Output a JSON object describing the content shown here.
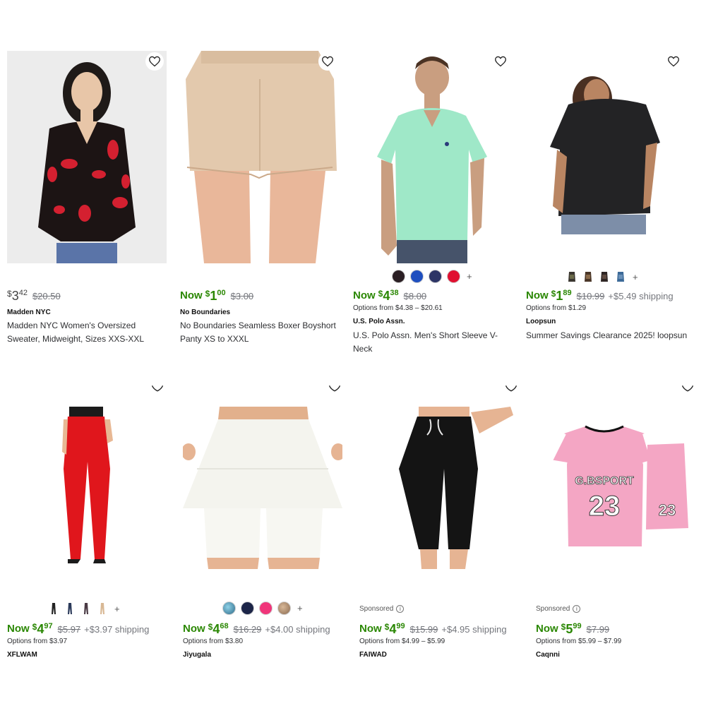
{
  "colors": {
    "accent_green": "#2a8703",
    "muted": "#74767c"
  },
  "products": [
    {
      "brand": "Madden NYC",
      "title": "Madden NYC Women's Oversized Sweater, Midweight, Sizes XXS-XXL",
      "now_label": "",
      "dollar": "$",
      "whole": "3",
      "cents": "42",
      "was": "$20.50",
      "shipping": "",
      "options": "",
      "sponsored": "",
      "favorite_icon": "heart-outline-icon"
    },
    {
      "brand": "No Boundaries",
      "title": "No Boundaries Seamless Boxer Boyshort Panty XS to XXXL",
      "now_label": "Now",
      "dollar": "$",
      "whole": "1",
      "cents": "00",
      "was": "$3.00",
      "shipping": "",
      "options": "",
      "sponsored": "",
      "favorite_icon": "heart-outline-icon"
    },
    {
      "brand": "U.S. Polo Assn.",
      "title": "U.S. Polo Assn. Men's Short Sleeve V-Neck",
      "now_label": "Now",
      "dollar": "$",
      "whole": "4",
      "cents": "38",
      "was": "$8.00",
      "shipping": "",
      "options": "Options from $4.38 – $20.61",
      "sponsored": "",
      "swatch_colors": [
        "#2b1f24",
        "#1f4fbf",
        "#2d3566",
        "#e01030"
      ],
      "more_label": "+",
      "favorite_icon": "heart-outline-icon"
    },
    {
      "brand": "Loopsun",
      "title": "Summer Savings Clearance 2025! loopsun",
      "now_label": "Now",
      "dollar": "$",
      "whole": "1",
      "cents": "89",
      "was": "$10.99",
      "shipping": "+$5.49 shipping",
      "options": "Options from $1.29",
      "sponsored": "",
      "more_label": "+",
      "favorite_icon": "heart-outline-icon"
    },
    {
      "brand": "XFLWAM",
      "title": "",
      "now_label": "Now",
      "dollar": "$",
      "whole": "4",
      "cents": "97",
      "was": "$5.97",
      "shipping": "+$3.97 shipping",
      "options": "Options from $3.97",
      "sponsored": "",
      "more_label": "+",
      "favorite_icon": "heart-outline-icon"
    },
    {
      "brand": "Jiyugala",
      "title": "",
      "now_label": "Now",
      "dollar": "$",
      "whole": "4",
      "cents": "68",
      "was": "$16.29",
      "shipping": "+$4.00 shipping",
      "options": "Options from $3.80",
      "sponsored": "",
      "more_label": "+",
      "favorite_icon": "heart-outline-icon"
    },
    {
      "brand": "FAIWAD",
      "title": "",
      "now_label": "Now",
      "dollar": "$",
      "whole": "4",
      "cents": "99",
      "was": "$15.99",
      "shipping": "+$4.95 shipping",
      "options": "Options from $4.99 – $5.99",
      "sponsored": "Sponsored",
      "favorite_icon": "heart-outline-icon"
    },
    {
      "brand": "Caqnni",
      "title": "",
      "now_label": "Now",
      "dollar": "$",
      "whole": "5",
      "cents": "99",
      "was": "$7.99",
      "shipping": "",
      "options": "Options from $5.99 – $7.99",
      "sponsored": "Sponsored",
      "favorite_icon": "heart-outline-icon"
    }
  ]
}
